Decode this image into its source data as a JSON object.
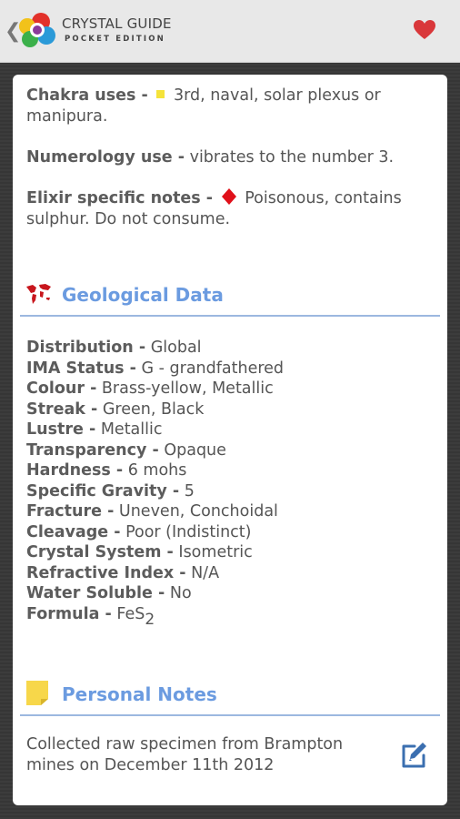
{
  "app": {
    "title": "CRYSTAL GUIDE",
    "subtitle": "POCKET EDITION",
    "back_icon": "chevron-left-icon",
    "favorite_icon": "heart-icon",
    "favorite_color": "#d9373a"
  },
  "properties": {
    "chakra_label": "Chakra uses -",
    "chakra_value": "3rd, naval, solar plexus or manipura.",
    "chakra_marker_color": "#f5e33a",
    "numerology_label": "Numerology use -",
    "numerology_value": "vibrates to the number 3.",
    "elixir_label": "Elixir specific notes -",
    "elixir_value": "Poisonous, contains sulphur. Do not consume.",
    "elixir_marker_color": "#e0101a"
  },
  "geological": {
    "heading": "Geological Data",
    "icon": "world-map-icon",
    "rows": [
      {
        "label": "Distribution -",
        "value": "Global"
      },
      {
        "label": "IMA Status -",
        "value": "G - grandfathered"
      },
      {
        "label": "Colour -",
        "value": "Brass-yellow, Metallic"
      },
      {
        "label": "Streak -",
        "value": "Green, Black"
      },
      {
        "label": "Lustre -",
        "value": "Metallic"
      },
      {
        "label": "Transparency -",
        "value": "Opaque"
      },
      {
        "label": "Hardness -",
        "value": "6 mohs"
      },
      {
        "label": "Specific Gravity -",
        "value": "5"
      },
      {
        "label": "Fracture -",
        "value": "Uneven, Conchoidal"
      },
      {
        "label": "Cleavage -",
        "value": "Poor (Indistinct)"
      },
      {
        "label": "Crystal System -",
        "value": "Isometric"
      },
      {
        "label": "Refractive Index -",
        "value": "N/A"
      },
      {
        "label": "Water Soluble -",
        "value": "No"
      }
    ],
    "formula_label": "Formula -",
    "formula_base": "FeS",
    "formula_sub": "2"
  },
  "notes": {
    "heading": "Personal Notes",
    "icon": "sticky-note-icon",
    "text": "Collected raw specimen from Brampton mines on December 11th 2012",
    "edit_icon": "edit-note-icon"
  }
}
